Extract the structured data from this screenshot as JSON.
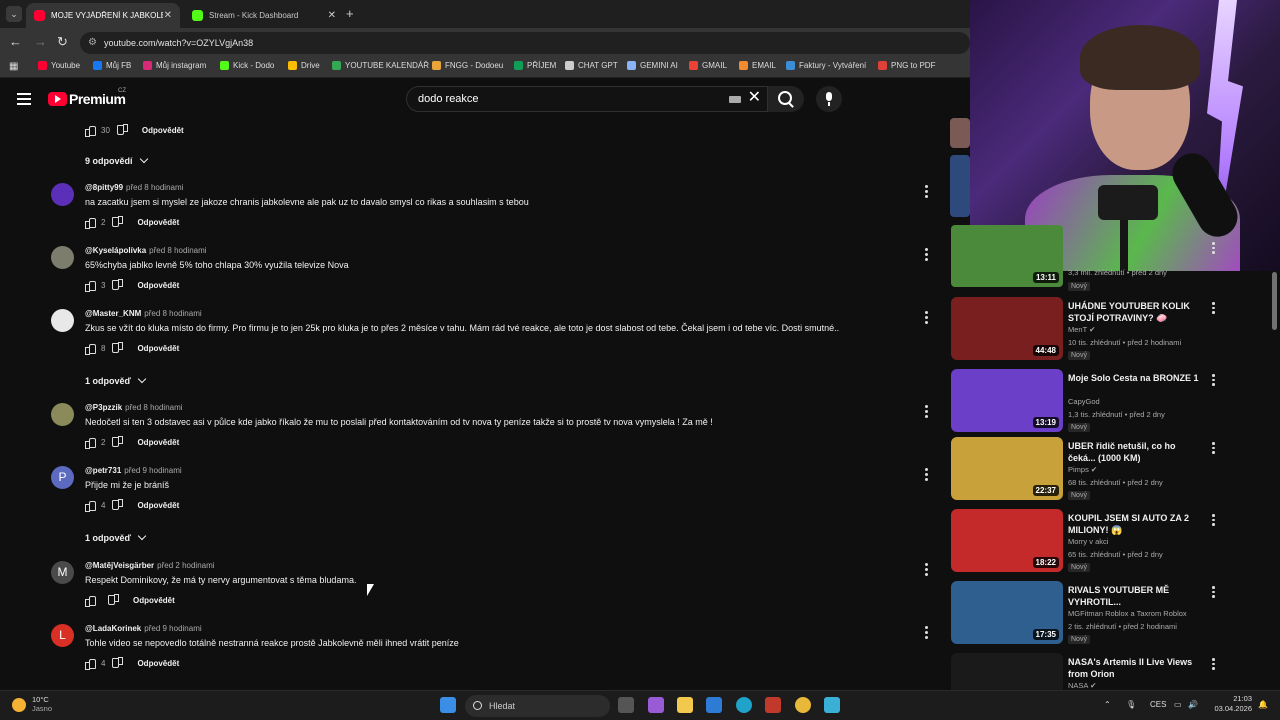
{
  "browser": {
    "tabs": [
      {
        "label": "MOJE VYJÁDŘENÍ K JABKOLEVN",
        "active": true,
        "favicon_color": "#ff0033"
      },
      {
        "label": "Stream - Kick Dashboard",
        "active": false,
        "favicon_color": "#53fc18"
      }
    ],
    "url": "youtube.com/watch?v=OZYLVgjAn38",
    "bookmarks": [
      {
        "label": "Youtube",
        "color": "#ff0033"
      },
      {
        "label": "Můj FB",
        "color": "#1877f2"
      },
      {
        "label": "Můj instagram",
        "color": "#d62976"
      },
      {
        "label": "Kick - Dodo",
        "color": "#53fc18"
      },
      {
        "label": "Drive",
        "color": "#fbbc04"
      },
      {
        "label": "YOUTUBE KALENDÁŘ",
        "color": "#34a853"
      },
      {
        "label": "FNGG - Dodoeu",
        "color": "#e8a33a"
      },
      {
        "label": "PŘÍJEM",
        "color": "#0f9d58"
      },
      {
        "label": "CHAT GPT",
        "color": "#cccccc"
      },
      {
        "label": "GEMINI AI",
        "color": "#8ab4f8"
      },
      {
        "label": "GMAIL",
        "color": "#ea4335"
      },
      {
        "label": "EMAIL",
        "color": "#f28b30"
      },
      {
        "label": "Faktury - Vytváření",
        "color": "#3b8ed6"
      },
      {
        "label": "PNG to PDF",
        "color": "#e0403a"
      }
    ]
  },
  "youtube": {
    "brand": "Premium",
    "country": "CZ",
    "search_query": "dodo reakce"
  },
  "top_actions": {
    "likes": "30",
    "reply": "Odpovědět"
  },
  "replies_toggles": [
    {
      "label": "9 odpovědí"
    },
    {
      "label": "1 odpověď"
    },
    {
      "label": "1 odpověď"
    }
  ],
  "comments": [
    {
      "author": "@8pitty99",
      "time": "před 8 hodinami",
      "text": "na zacatku jsem si myslel ze jakoze chranis jabkolevne ale pak uz to davalo smysl co rikas a souhlasim s tebou",
      "likes": "2",
      "reply": "Odpovědět",
      "avatar_letter": "",
      "avatar_color": "#5b2fb8"
    },
    {
      "author": "@Kyselápolívka",
      "time": "před 8 hodinami",
      "text": "65%chyba jablko levně 5% toho chlapa 30% využila televize Nova",
      "likes": "3",
      "reply": "Odpovědět",
      "avatar_letter": "",
      "avatar_color": "#7d7d6e"
    },
    {
      "author": "@Master_KNM",
      "time": "před 8 hodinami",
      "text": "Zkus se vžít do kluka místo do firmy. Pro firmu je to jen 25k pro kluka je to přes 2 měsíce v tahu. Mám rád tvé reakce, ale toto je dost slabost od tebe. Čekal jsem i od tebe víc. Dosti smutné..",
      "likes": "8",
      "reply": "Odpovědět",
      "avatar_letter": "",
      "avatar_color": "#e8e8e8"
    },
    {
      "author": "@P3pzzik",
      "time": "před 8 hodinami",
      "text": "Nedočetl si ten 3 odstavec asi v půlce kde jabko říkalo že mu to poslali před kontaktováním od tv nova ty peníze takže si to prostě tv nova vymyslela ! Za mě !",
      "likes": "2",
      "reply": "Odpovědět",
      "avatar_letter": "",
      "avatar_color": "#8a8a5a"
    },
    {
      "author": "@petr731",
      "time": "před 9 hodinami",
      "text": "Přijde mi že je bráníš",
      "likes": "4",
      "reply": "Odpovědět",
      "avatar_letter": "P",
      "avatar_color": "#5c6bc0"
    },
    {
      "author": "@MatějVeisgärber",
      "time": "před 2 hodinami",
      "text": "Respekt Dominikovy, že má ty nervy argumentovat s těma bludama.",
      "likes": "",
      "reply": "Odpovědět",
      "avatar_letter": "M",
      "avatar_color": "#4a4a4a"
    },
    {
      "author": "@LadaKorinek",
      "time": "před 9 hodinami",
      "text": "Tohle video se nepovedlo totálně nestranná reakce prostě Jabkolevně měli ihned vrátit peníze",
      "likes": "4",
      "reply": "Odpovědět",
      "avatar_letter": "L",
      "avatar_color": "#d93025"
    }
  ],
  "sidebar": {
    "partial_top": {
      "stats": "3,3 mil. zhlédnutí • před 2 dny",
      "badge": "Nový",
      "duration": "13:11"
    },
    "videos": [
      {
        "title": "UHÁDNE YOUTUBER KOLIK STOJÍ POTRAVINY? 🧼",
        "channel": "MenT ✔",
        "stats": "10 tis. zhlédnutí • před 2 hodinami",
        "badge": "Nový",
        "duration": "44:48",
        "thumb_color": "#7a1f1f"
      },
      {
        "title": "Moje Solo Cesta na BRONZE 1",
        "channel": "CapyGod",
        "stats": "1,3 tis. zhlédnutí • před 2 dny",
        "badge": "Nový",
        "duration": "13:19",
        "thumb_color": "#6b3fc7"
      },
      {
        "title": "UBER řidič netušil, co ho čeká... (1000 KM)",
        "channel": "Pimps ✔",
        "stats": "68 tis. zhlédnutí • před 2 dny",
        "badge": "Nový",
        "duration": "22:37",
        "thumb_color": "#c9a13a"
      },
      {
        "title": "KOUPIL JSEM SI AUTO ZA 2 MILIONY! 😱",
        "channel": "Morry v akci",
        "stats": "65 tis. zhlédnutí • před 2 dny",
        "badge": "Nový",
        "duration": "18:22",
        "thumb_color": "#c42a2a"
      },
      {
        "title": "RIVALS YOUTUBER MĚ VYHROTIL...",
        "channel": "MGFitman Roblox a Taxrom Roblox",
        "stats": "2 tis. zhlédnutí • před 2 hodinami",
        "badge": "Nový",
        "duration": "17:35",
        "thumb_color": "#2f5f8f"
      },
      {
        "title": "NASA's Artemis II Live Views from Orion",
        "channel": "NASA ✔",
        "stats": "",
        "badge": "",
        "duration": "",
        "thumb_color": "#1a1a1a"
      }
    ]
  },
  "taskbar": {
    "temp": "10°C",
    "weather": "Jasno",
    "search": "Hledat",
    "lang": "CES",
    "time": "21:03",
    "date": "03.04.2026"
  }
}
